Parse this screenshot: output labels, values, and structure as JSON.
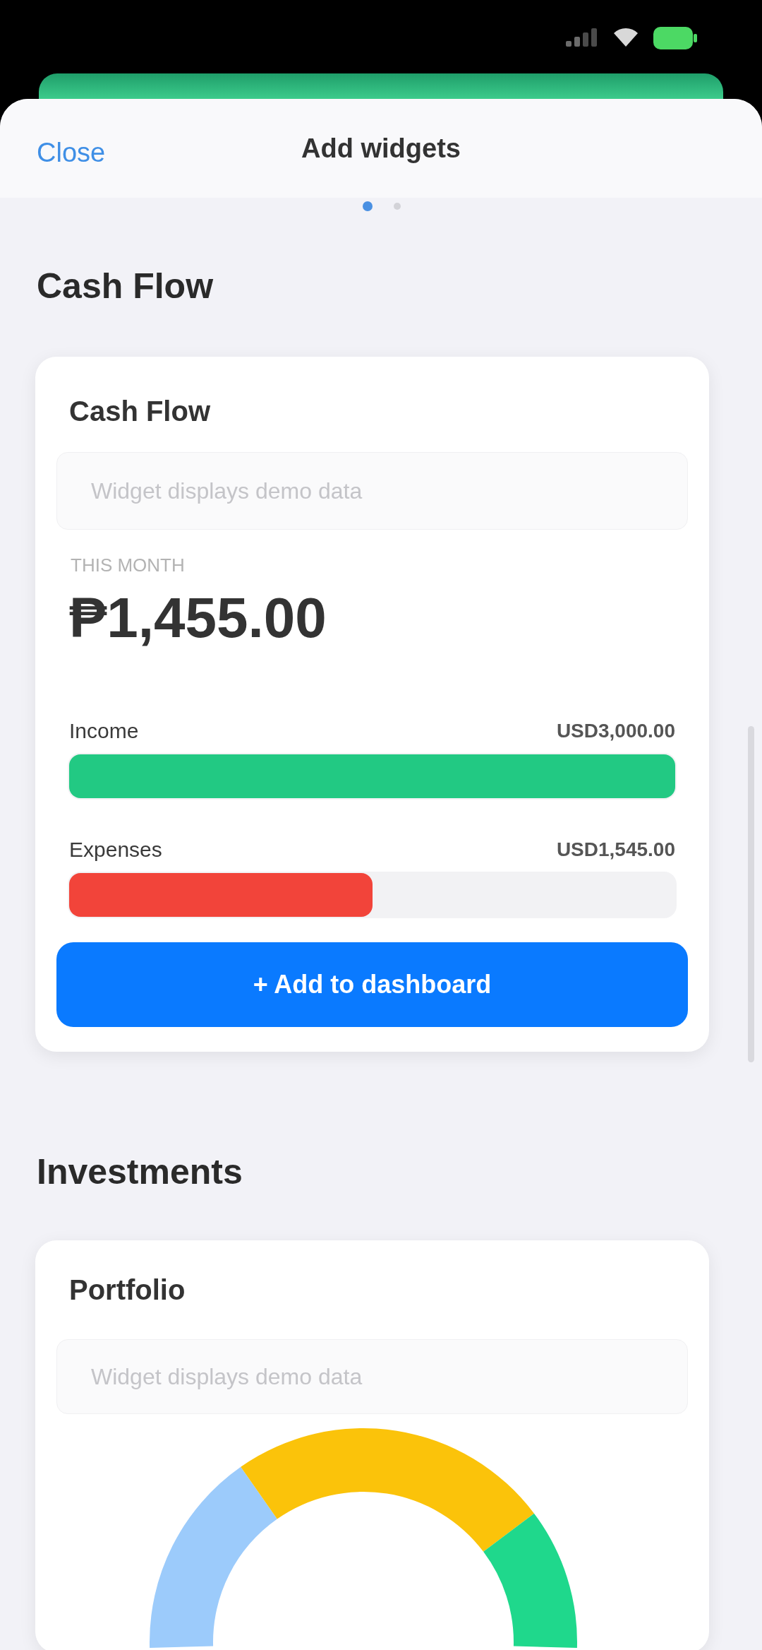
{
  "header": {
    "close": "Close",
    "title": "Add widgets",
    "pages": [
      {
        "selected": true
      },
      {
        "selected": false
      }
    ]
  },
  "sections": [
    {
      "title": "Cash Flow",
      "widget": {
        "kind": "cash_flow",
        "title": "Cash Flow",
        "notice": "Widget displays demo data",
        "period": "THIS MONTH",
        "total": "₱1,455.00",
        "bars": [
          {
            "label": "Income",
            "amount": "USD3,000.00",
            "level": 1,
            "color": "#22c983"
          },
          {
            "label": "Expenses",
            "amount": "USD1,545.00",
            "level": 0.5,
            "color": "#f2443a"
          }
        ],
        "button": "+ Add to dashboard"
      }
    },
    {
      "title": "Investments",
      "widget": {
        "kind": "portfolio",
        "title": "Portfolio",
        "notice": "Widget displays demo data"
      }
    }
  ]
}
